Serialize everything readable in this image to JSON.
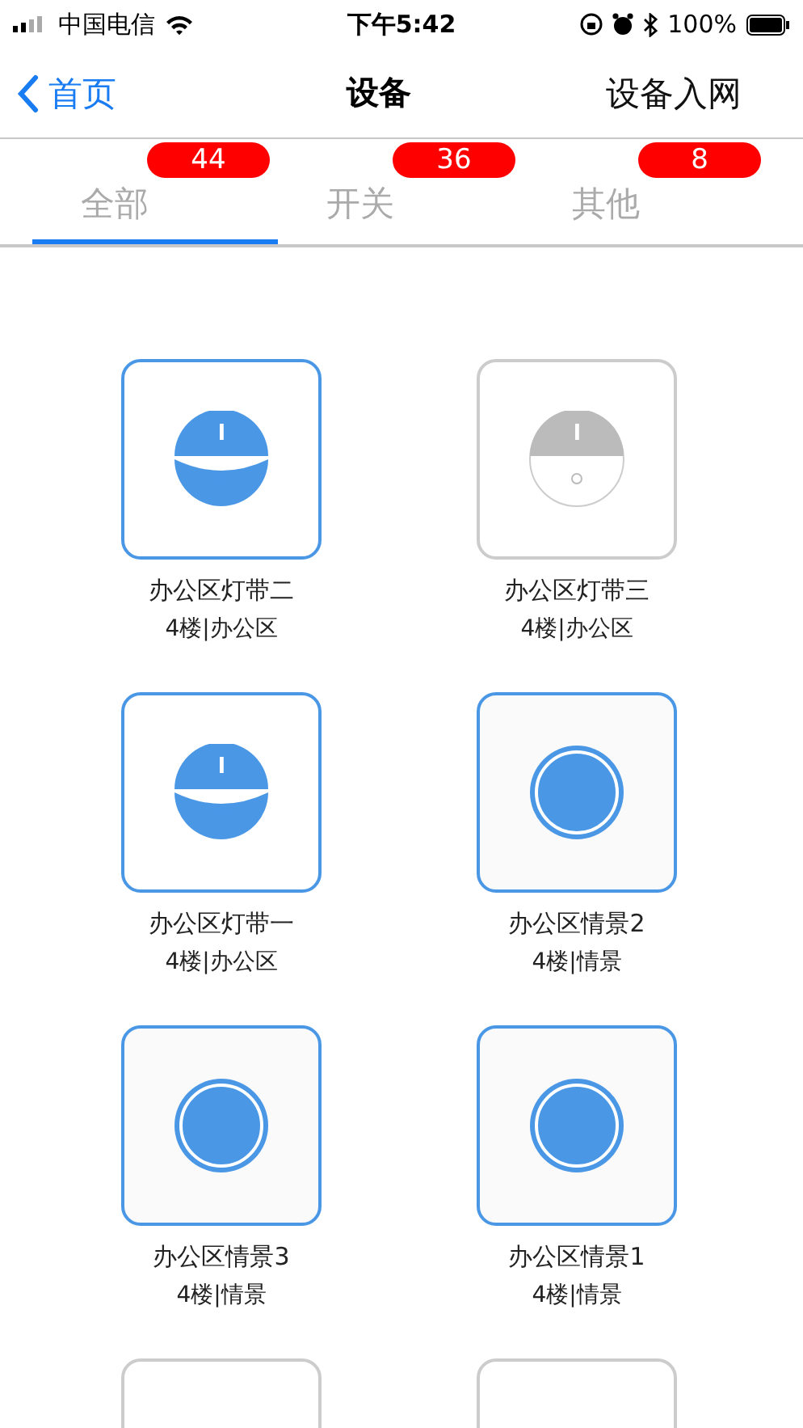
{
  "status_bar": {
    "carrier": "中国电信",
    "time": "下午5:42",
    "battery": "100%"
  },
  "nav": {
    "back": "首页",
    "title": "设备",
    "action": "设备入网"
  },
  "tabs": [
    {
      "label": "全部",
      "count": "44",
      "selected": true
    },
    {
      "label": "开关",
      "count": "36",
      "selected": false
    },
    {
      "label": "其他",
      "count": "8",
      "selected": false
    }
  ],
  "devices": [
    {
      "name": "办公区灯带二",
      "location": "4楼|办公区",
      "kind": "light-strip",
      "on": true
    },
    {
      "name": "办公区灯带三",
      "location": "4楼|办公区",
      "kind": "light-strip",
      "on": false
    },
    {
      "name": "办公区灯带一",
      "location": "4楼|办公区",
      "kind": "light-strip",
      "on": true
    },
    {
      "name": "办公区情景2",
      "location": "4楼|情景",
      "kind": "scene",
      "on": true
    },
    {
      "name": "办公区情景3",
      "location": "4楼|情景",
      "kind": "scene",
      "on": true
    },
    {
      "name": "办公区情景1",
      "location": "4楼|情景",
      "kind": "scene",
      "on": true
    },
    {
      "on": false
    },
    {
      "on": false
    }
  ]
}
